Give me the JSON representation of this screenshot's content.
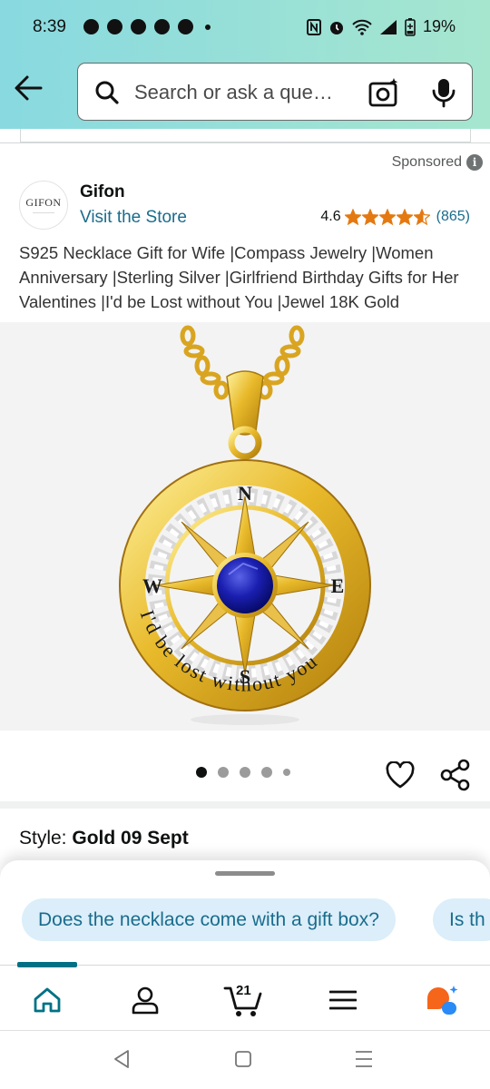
{
  "status_bar": {
    "time": "8:39",
    "battery": "19%"
  },
  "search": {
    "placeholder": "Search or ask a que…"
  },
  "listing": {
    "sponsored_label": "Sponsored",
    "brand_logo_text": "GIFON",
    "brand_name": "Gifon",
    "store_link": "Visit the Store",
    "rating_value": "4.6",
    "rating_count": "(865)",
    "stars": 4.6,
    "title": "S925 Necklace Gift for Wife |Compass Jewelry |Women Anniversary |Sterling Silver |Girlfriend Birthday Gifts for Her Valentines |I'd be Lost without You |Jewel 18K Gold"
  },
  "product_image": {
    "compass_letters": [
      "N",
      "E",
      "S",
      "W"
    ],
    "engraving": "I'd be lost without you"
  },
  "carousel": {
    "total_images": 5,
    "active_index": 0
  },
  "style": {
    "label": "Style: ",
    "value": "Gold 09 Sept"
  },
  "rufus": {
    "suggestions": [
      "Does the necklace come with a gift box?",
      "Is th"
    ]
  },
  "bottom_nav": {
    "cart_count": "21",
    "active_tab": "home"
  },
  "colors": {
    "link": "#1a6c8c",
    "star": "#e47911",
    "accent_teal": "#007185",
    "chip_bg": "#dbeefa"
  }
}
